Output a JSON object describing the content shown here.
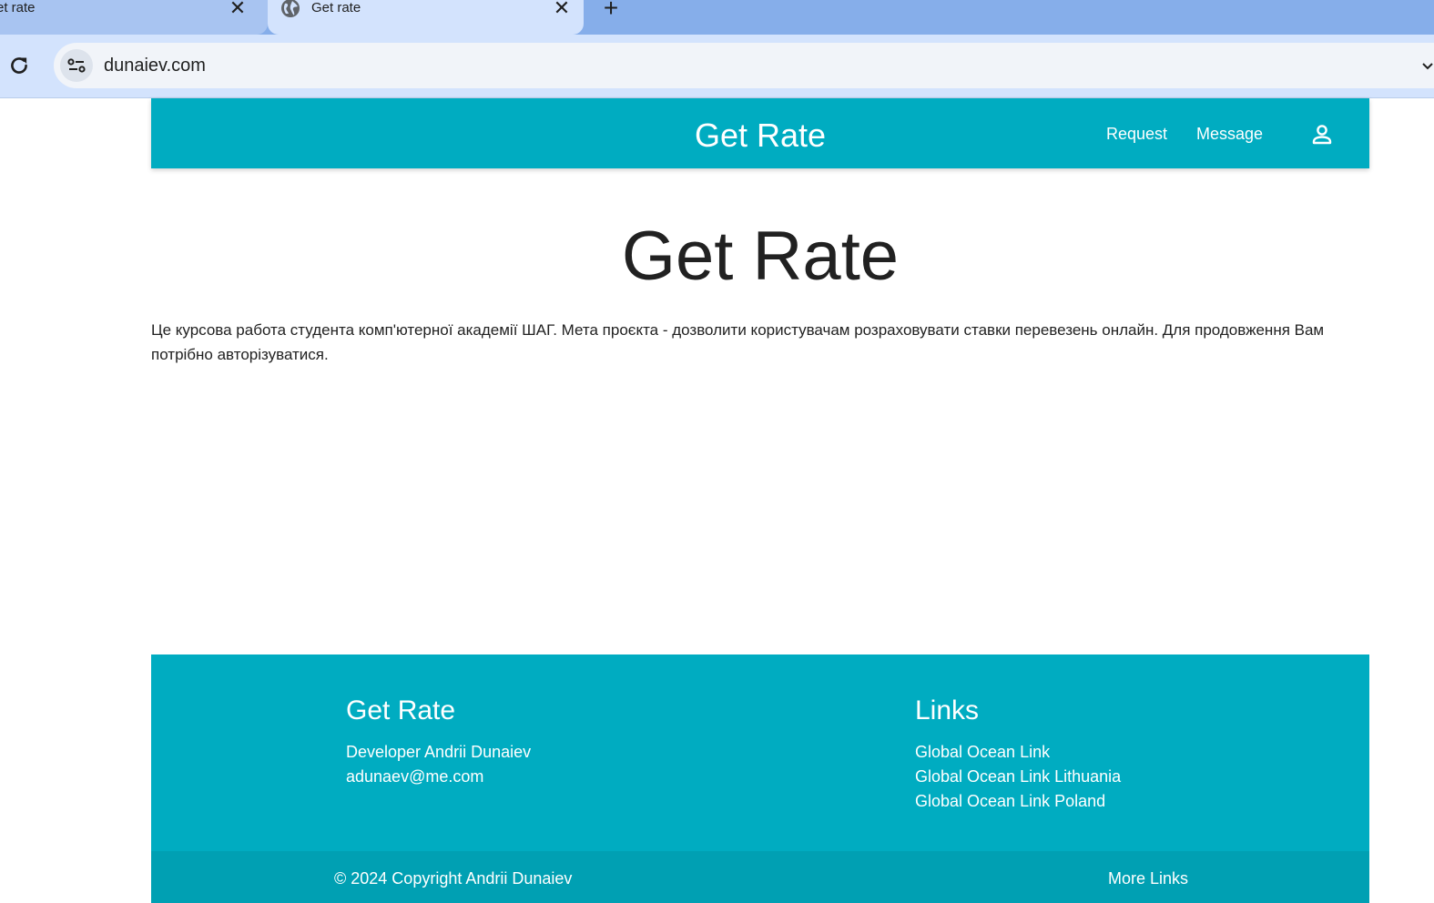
{
  "browser": {
    "tabs": [
      {
        "title": "et rate",
        "active": false
      },
      {
        "title": "Get rate",
        "active": true
      }
    ],
    "close_glyph": "✕",
    "new_tab_glyph": "+",
    "url": "dunaiev.com",
    "icons": {
      "favicon": "globe-icon",
      "reload": "reload-icon",
      "site_info": "site-settings-icon"
    }
  },
  "navbar": {
    "brand": "Get Rate",
    "links": [
      "Request",
      "Message"
    ],
    "user_icon": "account-icon",
    "color": "#00acc1"
  },
  "main": {
    "title": "Get Rate",
    "intro": "Це курсова работа студента комп'ютерної академії ШАГ. Мета проєкта - дозволити користувачам розраховувати ставки перевезень онлайн. Для продовження Вам потрібно авторізуватися."
  },
  "footer": {
    "col1": {
      "title": "Get Rate",
      "lines": [
        "Developer Andrii Dunaiev",
        "adunaev@me.com"
      ]
    },
    "col2": {
      "title": "Links",
      "links": [
        "Global Ocean Link",
        "Global Ocean Link Lithuania",
        "Global Ocean Link Poland"
      ]
    },
    "copyright": "© 2024 Copyright Andrii Dunaiev",
    "more_links": "More Links",
    "color": "#00acc1",
    "bottom_color": "#00a0b3"
  }
}
